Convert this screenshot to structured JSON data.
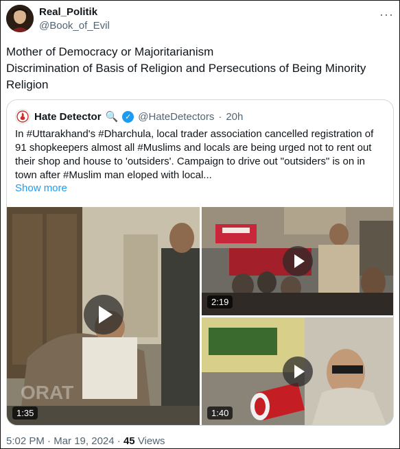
{
  "tweet": {
    "display_name": "Real_Politik",
    "handle": "@Book_of_Evil",
    "more_icon": "more-icon",
    "text_line1": "Mother of Democracy or Majoritarianism",
    "text_line2": "Discrimination of Basis of Religion and Persecutions of Being Minority Religion"
  },
  "quote": {
    "name": "Hate Detector",
    "emoji": "🔍",
    "verified_icon": "verified-badge-icon",
    "handle": "@HateDetectors",
    "separator": "·",
    "time": "20h",
    "text": "In #Uttarakhand's #Dharchula, local trader association cancelled registration of 91 shopkeepers almost all #Muslims and locals are being urged not to rent out their shop and house to 'outsiders'. Campaign to drive out \"outsiders\" is on in town after #Muslim man eloped with local...",
    "show_more": "Show more",
    "videos": [
      {
        "duration": "1:35",
        "icon": "play-icon"
      },
      {
        "duration": "2:19",
        "icon": "play-icon"
      },
      {
        "duration": "1:40",
        "icon": "play-icon"
      }
    ]
  },
  "footer": {
    "time": "5:02 PM",
    "sep1": "·",
    "date": "Mar 19, 2024",
    "sep2": "·",
    "views_count": "45",
    "views_label": "Views"
  },
  "colors": {
    "link": "#1d9bf0",
    "secondary_text": "#536471",
    "border": "#cfd9de"
  }
}
